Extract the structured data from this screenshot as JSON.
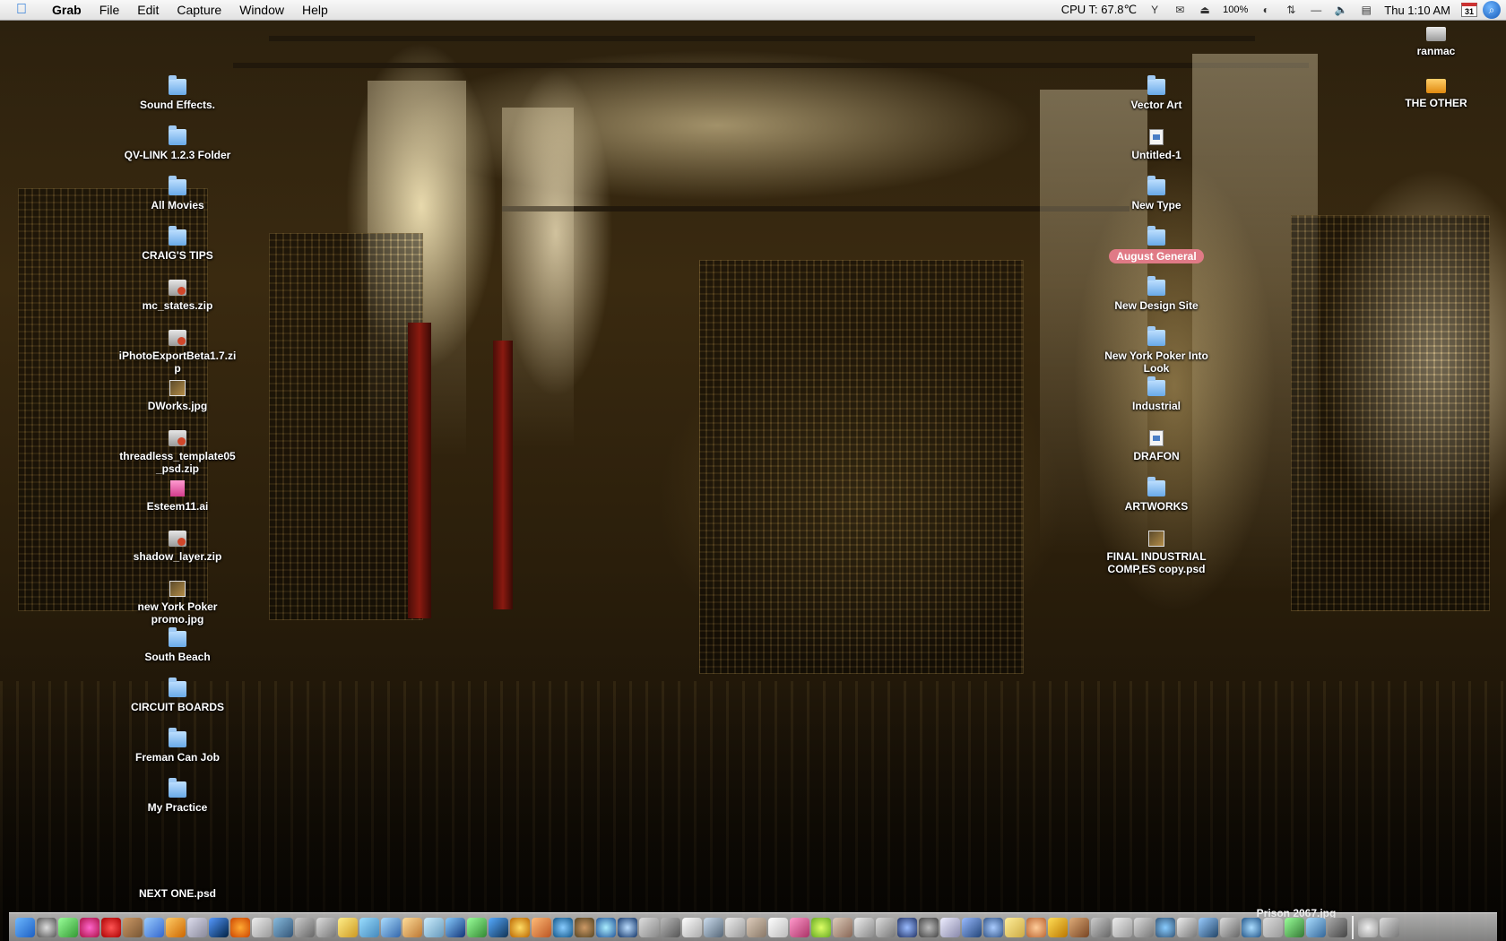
{
  "menubar": {
    "apple_icon": "apple-icon",
    "app_name": "Grab",
    "menus": [
      "File",
      "Edit",
      "Capture",
      "Window",
      "Help"
    ],
    "cpu_temp": "CPU T:  67.8℃",
    "battery": "100%",
    "clock": "Thu 1:10 AM",
    "calendar_day": "31"
  },
  "desktop": {
    "left_column": [
      {
        "label": "Sound Effects.",
        "kind": "folder"
      },
      {
        "label": "QV-LINK 1.2.3 Folder",
        "kind": "folder"
      },
      {
        "label": "All Movies",
        "kind": "folder"
      },
      {
        "label": "CRAIG'S TIPS",
        "kind": "folder"
      },
      {
        "label": "mc_states.zip",
        "kind": "zip"
      },
      {
        "label": "iPhotoExportBeta1.7.zip",
        "kind": "zip"
      },
      {
        "label": "DWorks.jpg",
        "kind": "jpg"
      },
      {
        "label": "threadless_template05_psd.zip",
        "kind": "zip"
      },
      {
        "label": "Esteem11.ai",
        "kind": "ai"
      },
      {
        "label": "shadow_layer.zip",
        "kind": "zip"
      },
      {
        "label": "new York Poker promo.jpg",
        "kind": "jpg"
      },
      {
        "label": "South Beach",
        "kind": "folder"
      },
      {
        "label": "CIRCUIT BOARDS",
        "kind": "folder"
      },
      {
        "label": "Freman Can Job",
        "kind": "folder"
      },
      {
        "label": "My Practice",
        "kind": "folder"
      },
      {
        "label": "NEXT ONE.psd",
        "kind": "jpg"
      }
    ],
    "right_column": [
      {
        "label": "Vector Art",
        "kind": "folder"
      },
      {
        "label": "Untitled-1",
        "kind": "doc"
      },
      {
        "label": "New Type",
        "kind": "folder"
      },
      {
        "label": "August General",
        "kind": "folder",
        "selected": true
      },
      {
        "label": "New Design Site",
        "kind": "folder"
      },
      {
        "label": "New York Poker Into Look",
        "kind": "folder"
      },
      {
        "label": "Industrial",
        "kind": "folder"
      },
      {
        "label": "DRAFON",
        "kind": "doc"
      },
      {
        "label": "ARTWORKS",
        "kind": "folder"
      },
      {
        "label": "FINAL INDUSTRIAL COMP,ES copy.psd",
        "kind": "jpg"
      }
    ],
    "volumes": [
      {
        "label": "ranmac",
        "kind": "disk"
      },
      {
        "label": "THE OTHER",
        "kind": "hd-orange"
      }
    ],
    "bottom_right_file": {
      "label": "Prison 2067.jpg",
      "kind": "jpg"
    }
  },
  "colors": {
    "selection_label": "#e07a86",
    "folder_blue": "#69a9e8",
    "menubar_bg": "#e8e8e8"
  }
}
